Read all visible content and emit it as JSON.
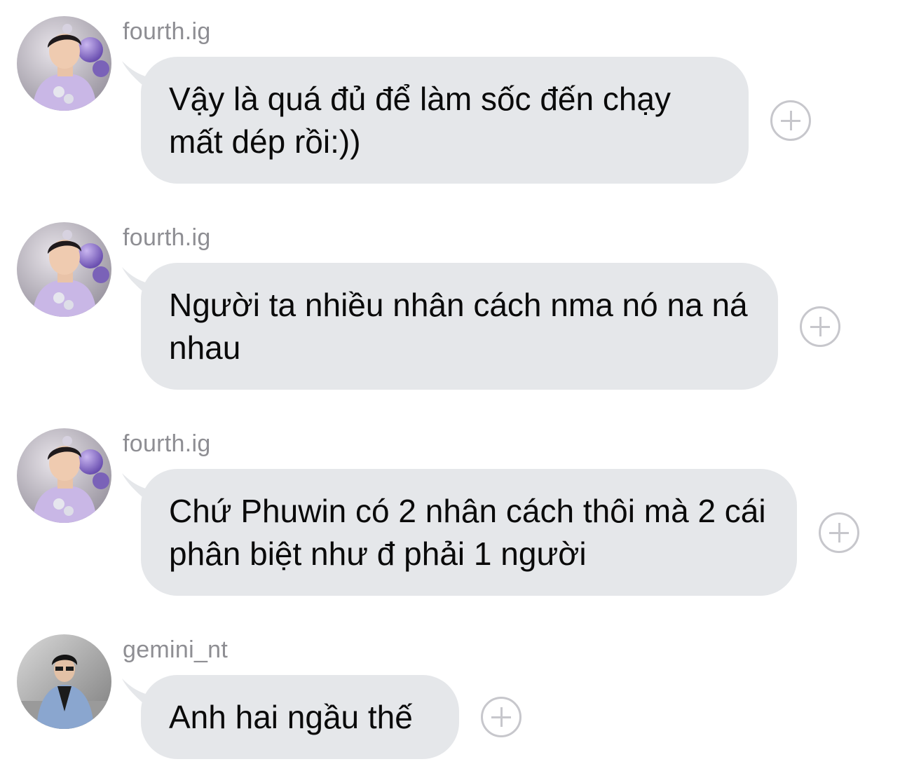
{
  "messages": [
    {
      "username": "fourth.ig",
      "text": "Vậy là quá đủ để làm sốc đến chạy mất dép rồi:))",
      "avatar": "fourth-avatar"
    },
    {
      "username": "fourth.ig",
      "text": "Người ta nhiều nhân cách nma nó na ná nhau",
      "avatar": "fourth-avatar"
    },
    {
      "username": "fourth.ig",
      "text": "Chứ Phuwin có 2 nhân cách thôi mà 2 cái phân biệt như đ phải 1 người",
      "avatar": "fourth-avatar"
    },
    {
      "username": "gemini_nt",
      "text": "Anh hai ngầu thế",
      "avatar": "gemini-avatar"
    }
  ],
  "colors": {
    "bubble": "#e5e7ea",
    "username": "#8e8e93",
    "text": "#0a0a0a",
    "icon": "#c7c7cc"
  }
}
